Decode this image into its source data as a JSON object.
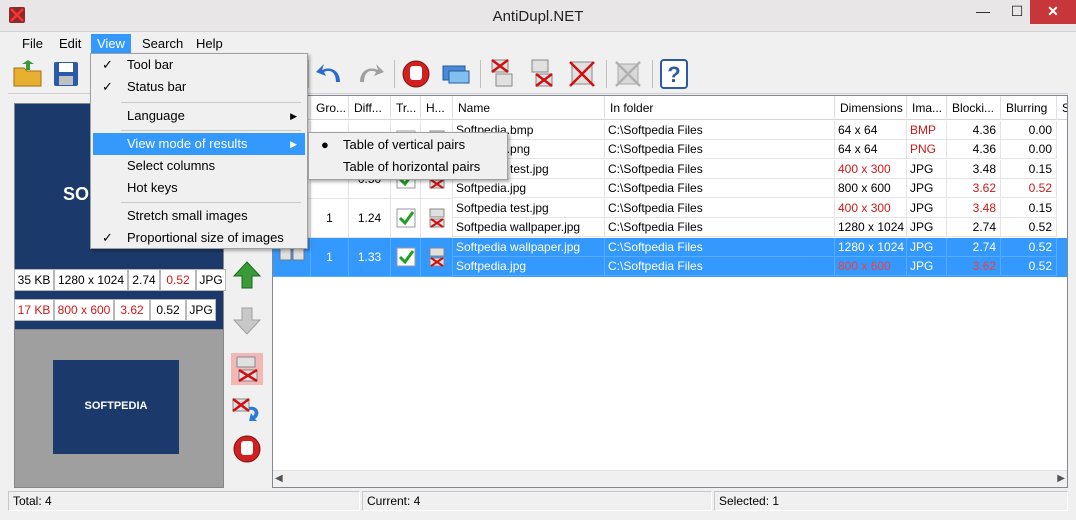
{
  "window": {
    "title": "AntiDupl.NET",
    "min": "—",
    "max": "☐",
    "close": "✕"
  },
  "menubar": [
    "File",
    "Edit",
    "View",
    "Search",
    "Help"
  ],
  "view_menu": {
    "items": [
      {
        "label": "Tool bar",
        "checked": "✓"
      },
      {
        "label": "Status bar",
        "checked": "✓"
      },
      {
        "label": "Language",
        "arrow": "▶"
      },
      {
        "label": "View mode of results",
        "arrow": "▶"
      },
      {
        "label": "Select columns"
      },
      {
        "label": "Hot keys"
      },
      {
        "label": "Stretch small images"
      },
      {
        "label": "Proportional size of images",
        "checked": "✓"
      }
    ],
    "submenu": [
      {
        "label": "Table of vertical pairs",
        "bullet": "●"
      },
      {
        "label": "Table of horizontal pairs"
      }
    ]
  },
  "preview": {
    "top_logo": "SOFTPEDIA",
    "top_logo_visible": "SO",
    "bottom_logo": "SOFTPEDIA",
    "top_info": [
      "35 KB",
      "1280 x 1024",
      "2.74",
      "0.52",
      "JPG"
    ],
    "bottom_info": [
      "17 KB",
      "800 x 600",
      "3.62",
      "0.52",
      "JPG"
    ]
  },
  "grid": {
    "headers": [
      "Gro...",
      "Diff...",
      "Tr...",
      "H...",
      "Name",
      "In folder",
      "Dimensions",
      "Ima...",
      "Blocki...",
      "Blurring",
      "S"
    ],
    "rows": [
      {
        "group": "",
        "diff": "",
        "files": [
          {
            "name": "Softpedia.bmp",
            "folder": "C:\\Softpedia Files",
            "dims": "64 x 64",
            "type": "BMP",
            "block": "4.36",
            "blur": "0.00"
          },
          {
            "name": "Softpedia.png",
            "folder": "C:\\Softpedia Files",
            "dims": "64 x 64",
            "type": "PNG",
            "block": "4.36",
            "blur": "0.00"
          }
        ]
      },
      {
        "group": "",
        "diff": "0.50",
        "files": [
          {
            "name": "Softpedia test.jpg",
            "folder": "C:\\Softpedia Files",
            "dims": "400 x 300",
            "type": "JPG",
            "block": "3.48",
            "blur": "0.15"
          },
          {
            "name": "Softpedia.jpg",
            "folder": "C:\\Softpedia Files",
            "dims": "800 x 600",
            "type": "JPG",
            "block": "3.62",
            "blur": "0.52"
          }
        ]
      },
      {
        "group": "1",
        "diff": "1.24",
        "files": [
          {
            "name": "Softpedia test.jpg",
            "folder": "C:\\Softpedia Files",
            "dims": "400 x 300",
            "type": "JPG",
            "block": "3.48",
            "blur": "0.15"
          },
          {
            "name": "Softpedia wallpaper.jpg",
            "folder": "C:\\Softpedia Files",
            "dims": "1280 x 1024",
            "type": "JPG",
            "block": "2.74",
            "blur": "0.52"
          }
        ]
      },
      {
        "group": "1",
        "diff": "1.33",
        "files": [
          {
            "name": "Softpedia wallpaper.jpg",
            "folder": "C:\\Softpedia Files",
            "dims": "1280 x 1024",
            "type": "JPG",
            "block": "2.74",
            "blur": "0.52"
          },
          {
            "name": "Softpedia.jpg",
            "folder": "C:\\Softpedia Files",
            "dims": "800 x 600",
            "type": "JPG",
            "block": "3.62",
            "blur": "0.52"
          }
        ]
      }
    ],
    "scroll_left": "◀",
    "scroll_right": "▶"
  },
  "statusbar": {
    "total": "Total: 4",
    "current": "Current: 4",
    "selected": "Selected: 1"
  },
  "colors": {
    "accent": "#3399ff",
    "diff_red": "#d01818",
    "logo_bg": "#1b3a6b"
  }
}
